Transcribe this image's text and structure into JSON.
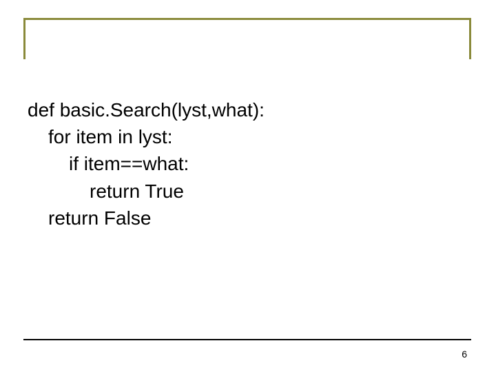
{
  "code": {
    "line1": "def basic.Search(lyst,what):",
    "line2": "for item in lyst:",
    "line3": "if item==what:",
    "line4": "return True",
    "line5": "return False"
  },
  "page_number": "6"
}
